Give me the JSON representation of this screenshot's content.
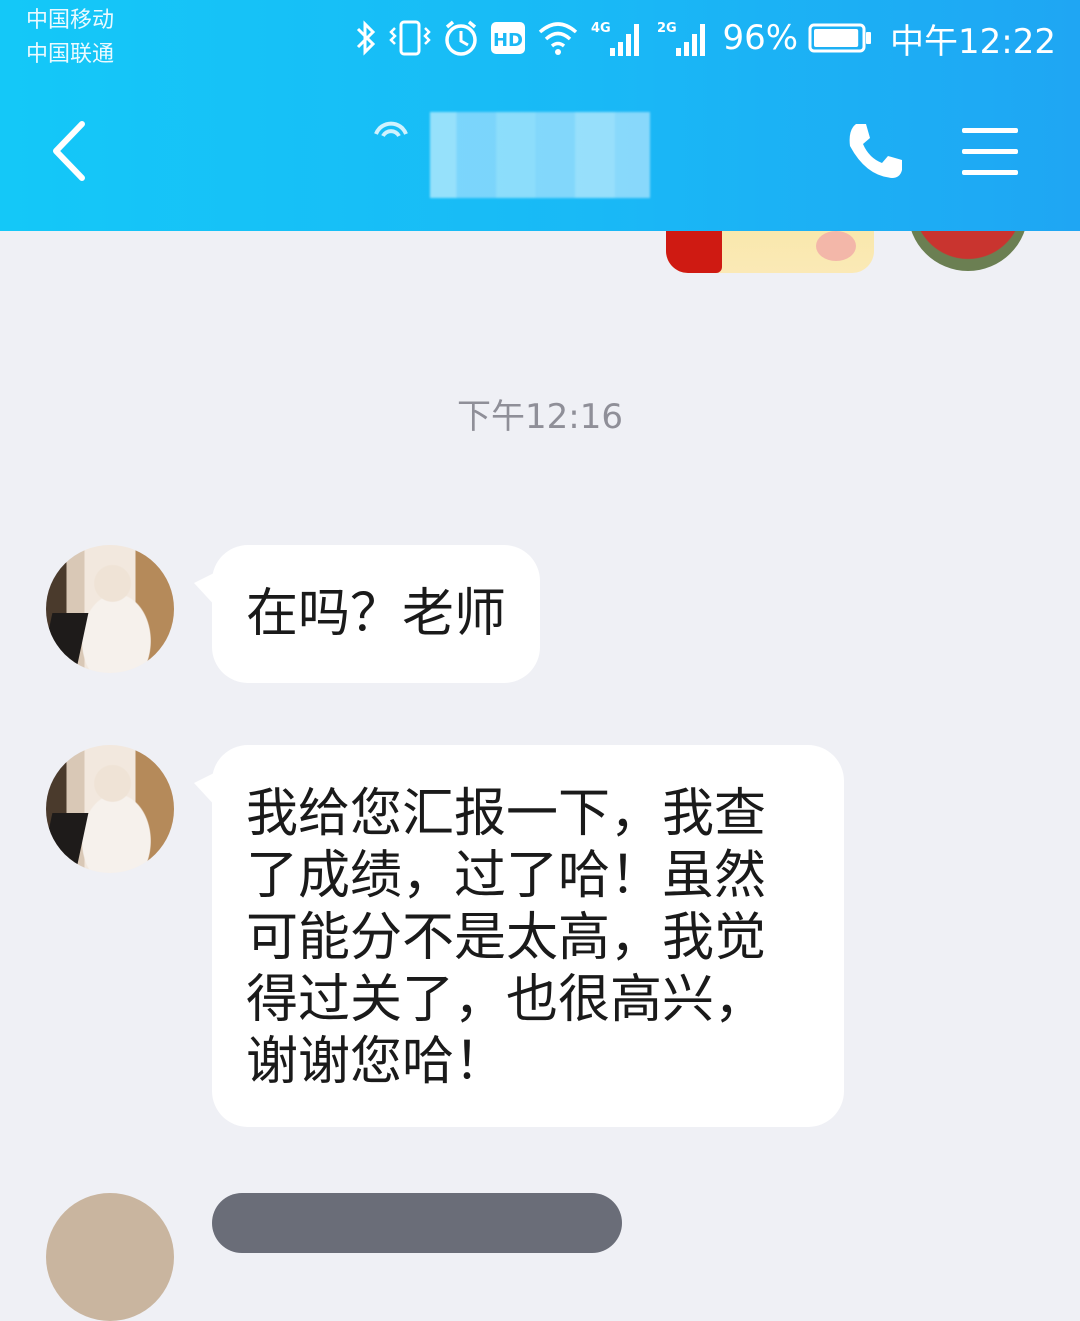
{
  "status_bar": {
    "carrier_1": "中国移动",
    "carrier_2": "中国联通",
    "network_1": "4G",
    "network_2": "2G",
    "hd_label": "HD",
    "battery_percent": "96%",
    "battery_level": 0.96,
    "time": "中午12:22",
    "icons": [
      "bluetooth-icon",
      "vibrate-icon",
      "alarm-icon",
      "hd-icon",
      "wifi-icon",
      "signal-icon",
      "battery-icon"
    ]
  },
  "header": {
    "colors": {
      "gradient_start": "#14c8f8",
      "gradient_end": "#1fa6f3"
    },
    "title": "",
    "icons": [
      "back-arrow-icon",
      "phone-icon",
      "menu-icon"
    ]
  },
  "chat": {
    "timestamp": "下午12:16",
    "messages": [
      {
        "sender": "contact",
        "text": "在吗？老师"
      },
      {
        "sender": "contact",
        "text": "我给您汇报一下，我查了成绩，过了哈！虽然可能分不是太高，我觉得过关了，也很高兴，谢谢您哈！"
      }
    ]
  }
}
